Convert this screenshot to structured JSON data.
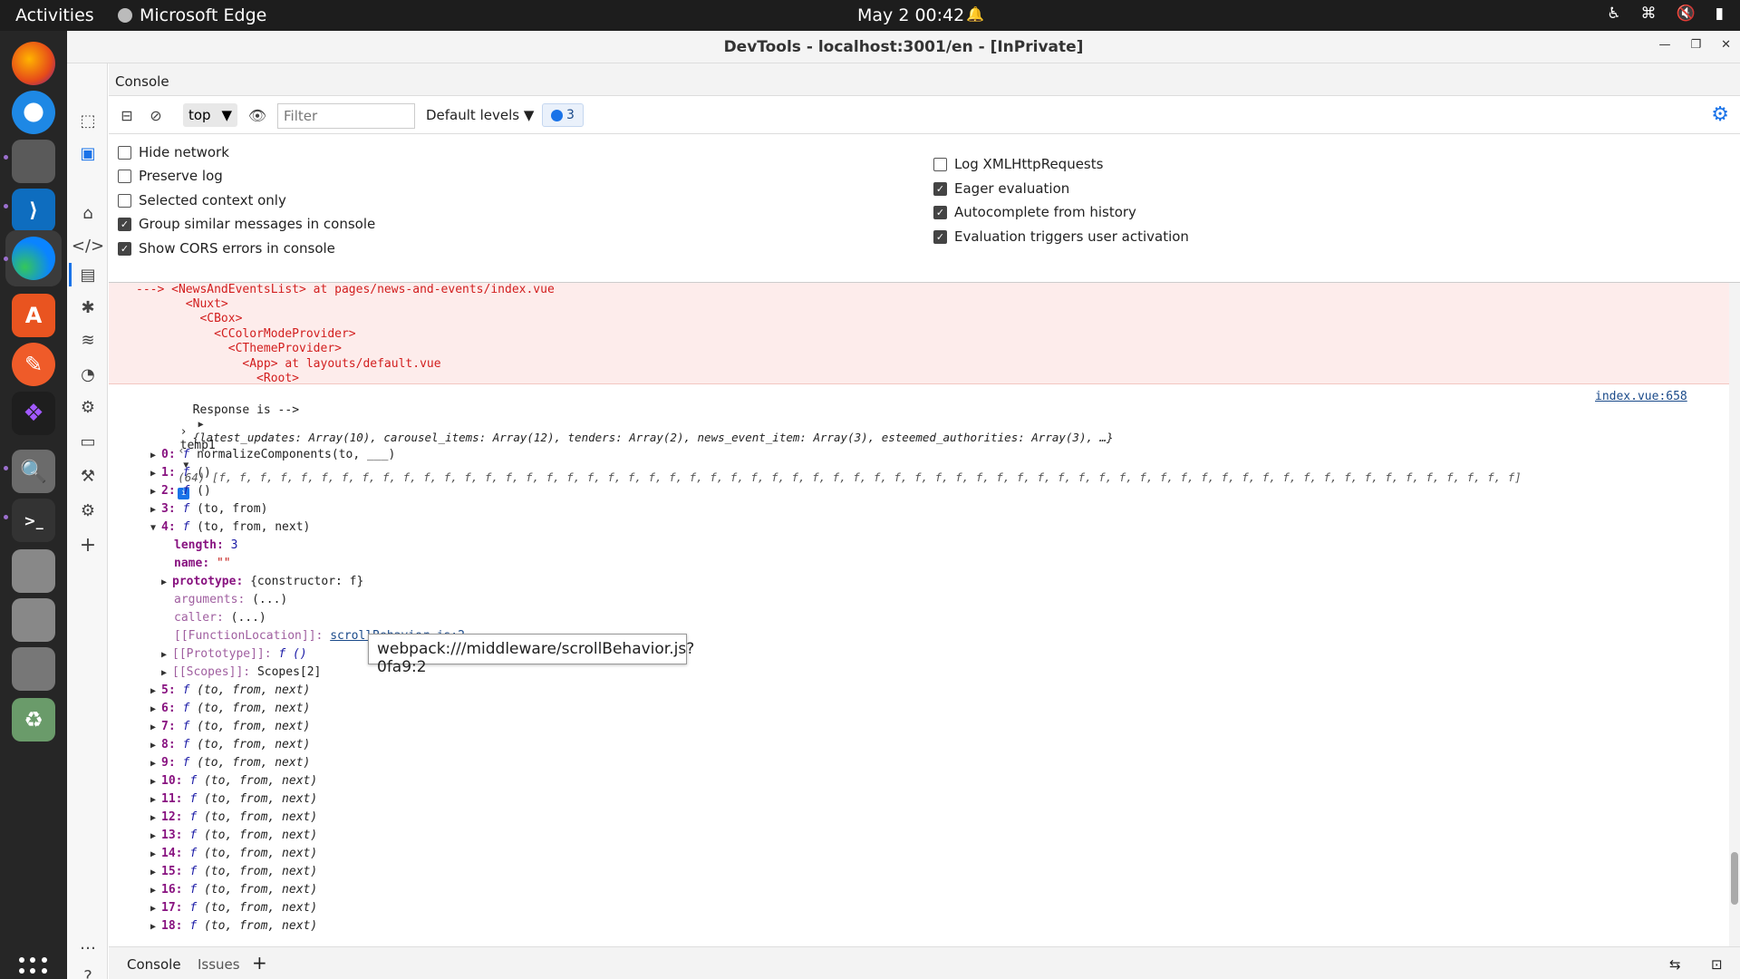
{
  "system": {
    "activities": "Activities",
    "app_name": "Microsoft Edge",
    "clock": "May 2  00:42"
  },
  "window": {
    "title": "DevTools - localhost:3001/en - [InPrivate]"
  },
  "panel": {
    "name": "Console"
  },
  "toolbar": {
    "context": "top",
    "filter_placeholder": "Filter",
    "levels": "Default levels",
    "message_count": "3"
  },
  "settings": {
    "left": [
      {
        "label": "Hide network",
        "checked": false
      },
      {
        "label": "Preserve log",
        "checked": false
      },
      {
        "label": "Selected context only",
        "checked": false
      },
      {
        "label": "Group similar messages in console",
        "checked": true
      },
      {
        "label": "Show CORS errors in console",
        "checked": true
      }
    ],
    "right": [
      {
        "label": "Log XMLHttpRequests",
        "checked": false
      },
      {
        "label": "Eager evaluation",
        "checked": true
      },
      {
        "label": "Autocomplete from history",
        "checked": true
      },
      {
        "label": "Evaluation triggers user activation",
        "checked": true
      }
    ]
  },
  "console": {
    "error_lines": [
      "---> <NewsAndEventsList> at pages/news-and-events/index.vue",
      "       <Nuxt>",
      "         <CBox>",
      "           <CColorModeProvider>",
      "             <CThemeProvider>",
      "               <App> at layouts/default.vue",
      "                 <Root>"
    ],
    "response_label": "Response is -->",
    "response_value": "{latest_updates: Array(10), carousel_items: Array(12), tenders: Array(2), news_event_item: Array(3), esteemed_authorities: Array(3), …}",
    "response_source": "index.vue:658",
    "input": "temp1",
    "array_summary": "(64) [f, f, f, f, f, f, f, f, f, f, f, f, f, f, f, f, f, f, f, f, f, f, f, f, f, f, f, f, f, f, f, f, f, f, f, f, f, f, f, f, f, f, f, f, f, f, f, f, f, f, f, f, f, f, f, f, f, f, f, f, f, f, f, f]",
    "items_top": [
      {
        "key": "0",
        "sig": "normalizeComponents(to, ___)"
      },
      {
        "key": "1",
        "sig": "()"
      },
      {
        "key": "2",
        "sig": "()"
      },
      {
        "key": "3",
        "sig": "(to, from)"
      },
      {
        "key": "4",
        "sig": "(to, from, next)"
      }
    ],
    "item4_props": {
      "length_key": "length",
      "length_val": "3",
      "name_key": "name",
      "name_val": "\"\"",
      "prototype_key": "prototype",
      "prototype_val": "{constructor: f}",
      "arguments_key": "arguments",
      "arguments_val": "(...)",
      "caller_key": "caller",
      "caller_val": "(...)",
      "location_key": "[[FunctionLocation]]",
      "location_val": "scrollBehavior.js:2",
      "proto_key": "[[Prototype]]",
      "proto_val": "f ()",
      "scopes_key": "[[Scopes]]",
      "scopes_val": "Scopes[2]"
    },
    "items_bottom": [
      {
        "key": "5",
        "sig": "(to, from, next)"
      },
      {
        "key": "6",
        "sig": "(to, from, next)"
      },
      {
        "key": "7",
        "sig": "(to, from, next)"
      },
      {
        "key": "8",
        "sig": "(to, from, next)"
      },
      {
        "key": "9",
        "sig": "(to, from, next)"
      },
      {
        "key": "10",
        "sig": "(to, from, next)"
      },
      {
        "key": "11",
        "sig": "(to, from, next)"
      },
      {
        "key": "12",
        "sig": "(to, from, next)"
      },
      {
        "key": "13",
        "sig": "(to, from, next)"
      },
      {
        "key": "14",
        "sig": "(to, from, next)"
      },
      {
        "key": "15",
        "sig": "(to, from, next)"
      },
      {
        "key": "16",
        "sig": "(to, from, next)"
      },
      {
        "key": "17",
        "sig": "(to, from, next)"
      },
      {
        "key": "18",
        "sig": "(to, from, next)"
      }
    ],
    "tooltip": "webpack:///middleware/scrollBehavior.js?0fa9:2"
  },
  "drawer": {
    "tabs": [
      "Console",
      "Issues"
    ]
  },
  "colors": {
    "accent": "#1a73e8",
    "error_bg": "#fdeceb",
    "error_text": "#d21e1e"
  }
}
